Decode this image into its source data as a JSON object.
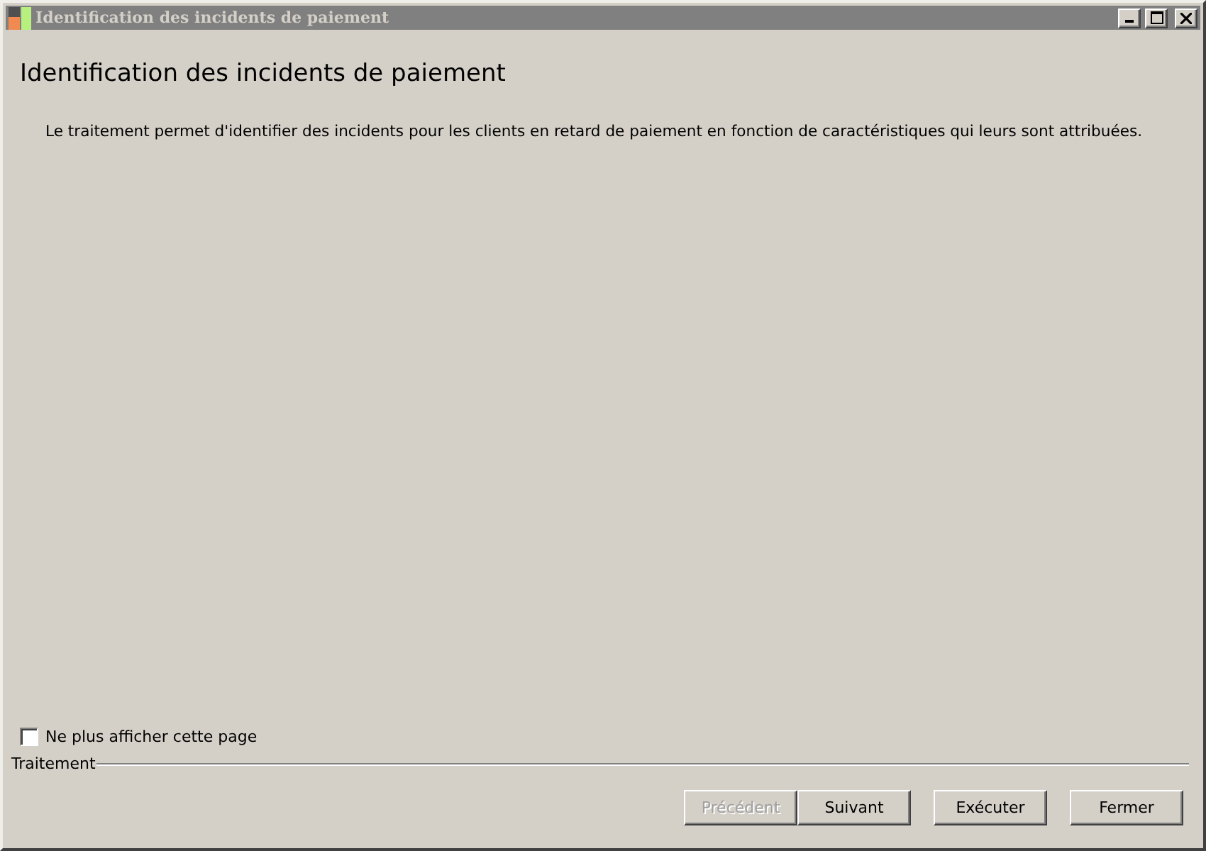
{
  "window": {
    "title": "Identification des incidents de paiement"
  },
  "heading": "Identification des incidents de paiement",
  "description": "Le traitement permet d'identifier des incidents pour les clients en retard de paiement en fonction de caractéristiques qui leurs sont attribuées.",
  "dont_show_again": {
    "label": "Ne plus afficher cette page",
    "checked": false
  },
  "group": {
    "label": "Traitement"
  },
  "buttons": [
    {
      "label": "Précédent",
      "disabled": true,
      "gap_before": false
    },
    {
      "label": "Suivant",
      "disabled": false,
      "gap_before": false
    },
    {
      "label": "Exécuter",
      "disabled": false,
      "gap_before": true
    },
    {
      "label": "Fermer",
      "disabled": false,
      "gap_before": true
    }
  ]
}
